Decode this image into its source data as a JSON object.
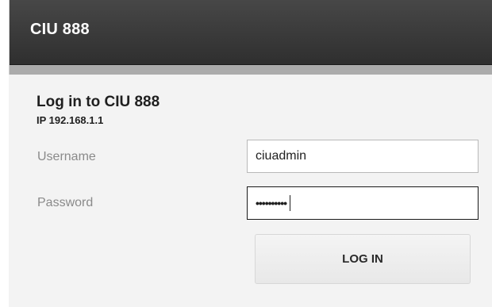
{
  "header": {
    "title": "CIU 888"
  },
  "login": {
    "heading": "Log in to CIU 888",
    "ip_label": "IP 192.168.1.1",
    "username_label": "Username",
    "username_value": "ciuadmin",
    "password_label": "Password",
    "password_masked": "••••••••••",
    "button_label": "LOG IN"
  },
  "colors": {
    "header_bg": "#3b3b3b",
    "header_text": "#ffffff",
    "subbar": "#ababab",
    "panel_bg": "#f3f3f3",
    "label_text": "#8a8a8a",
    "heading_text": "#1f1f1f",
    "focused_border": "#1a1a1a"
  }
}
